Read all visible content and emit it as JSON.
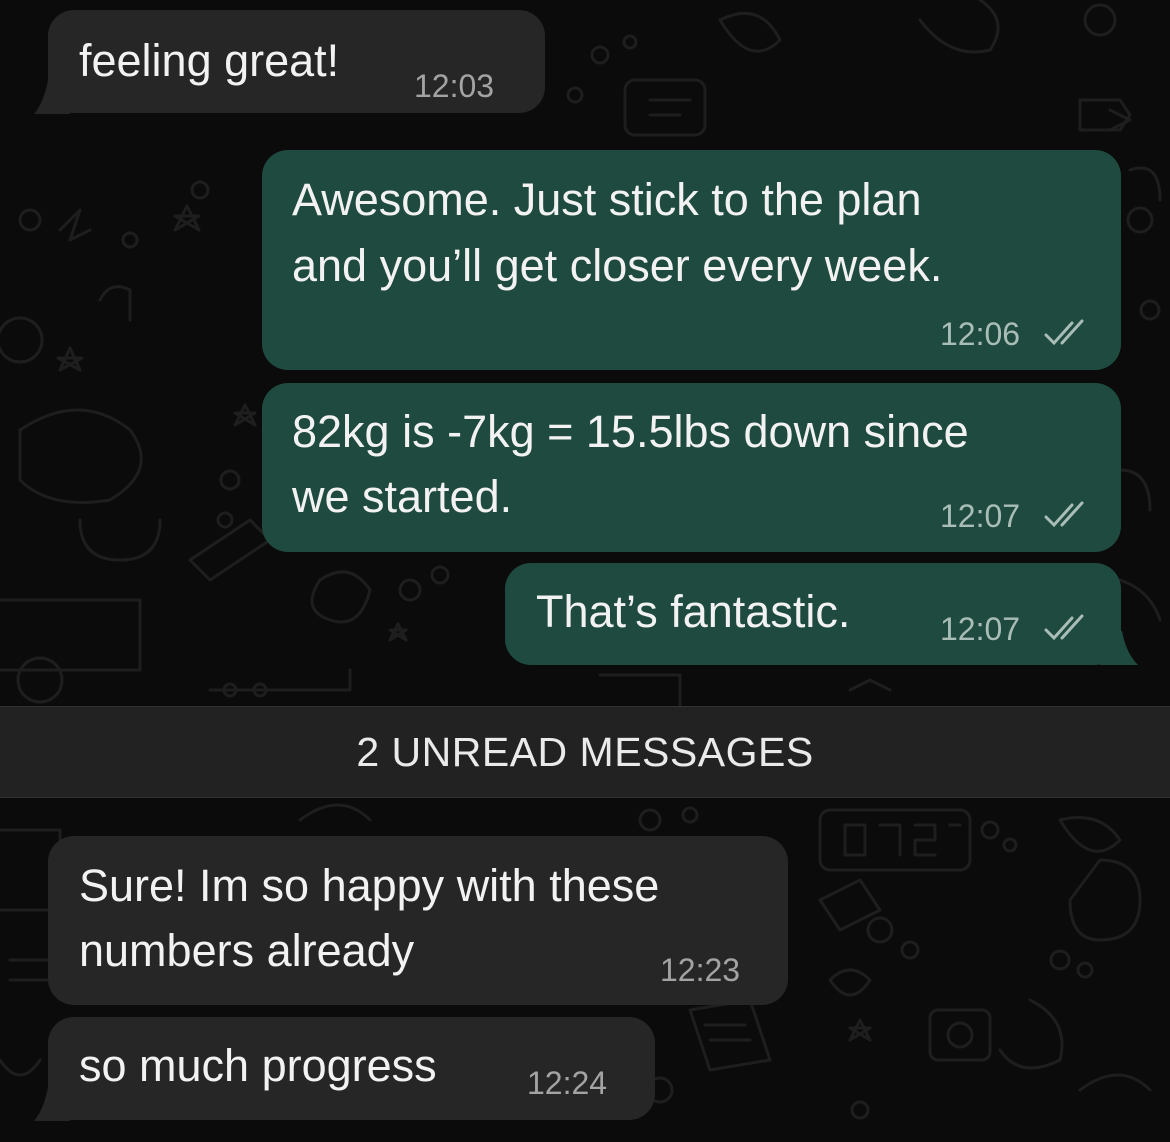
{
  "theme": {
    "incoming_bubble": "#262626",
    "outgoing_bubble": "#1f4a3f",
    "background": "#0b0b0b"
  },
  "messages": [
    {
      "direction": "incoming",
      "text": "feeling great!",
      "time": "12:03"
    },
    {
      "direction": "outgoing",
      "text_lines": [
        "Awesome. Just stick to the plan",
        "and you’ll get closer every week."
      ],
      "time": "12:06",
      "status": "read-double-check-icon"
    },
    {
      "direction": "outgoing",
      "text_lines": [
        "82kg is -7kg = 15.5lbs down since",
        "we started."
      ],
      "time": "12:07",
      "status": "read-double-check-icon"
    },
    {
      "direction": "outgoing",
      "text": "That’s fantastic.",
      "time": "12:07",
      "status": "read-double-check-icon"
    }
  ],
  "unread_divider": {
    "label": "2 UNREAD MESSAGES"
  },
  "unread_messages": [
    {
      "direction": "incoming",
      "text_lines": [
        "Sure! Im so happy with these",
        "numbers already"
      ],
      "time": "12:23"
    },
    {
      "direction": "incoming",
      "text": "so much progress",
      "time": "12:24"
    }
  ]
}
